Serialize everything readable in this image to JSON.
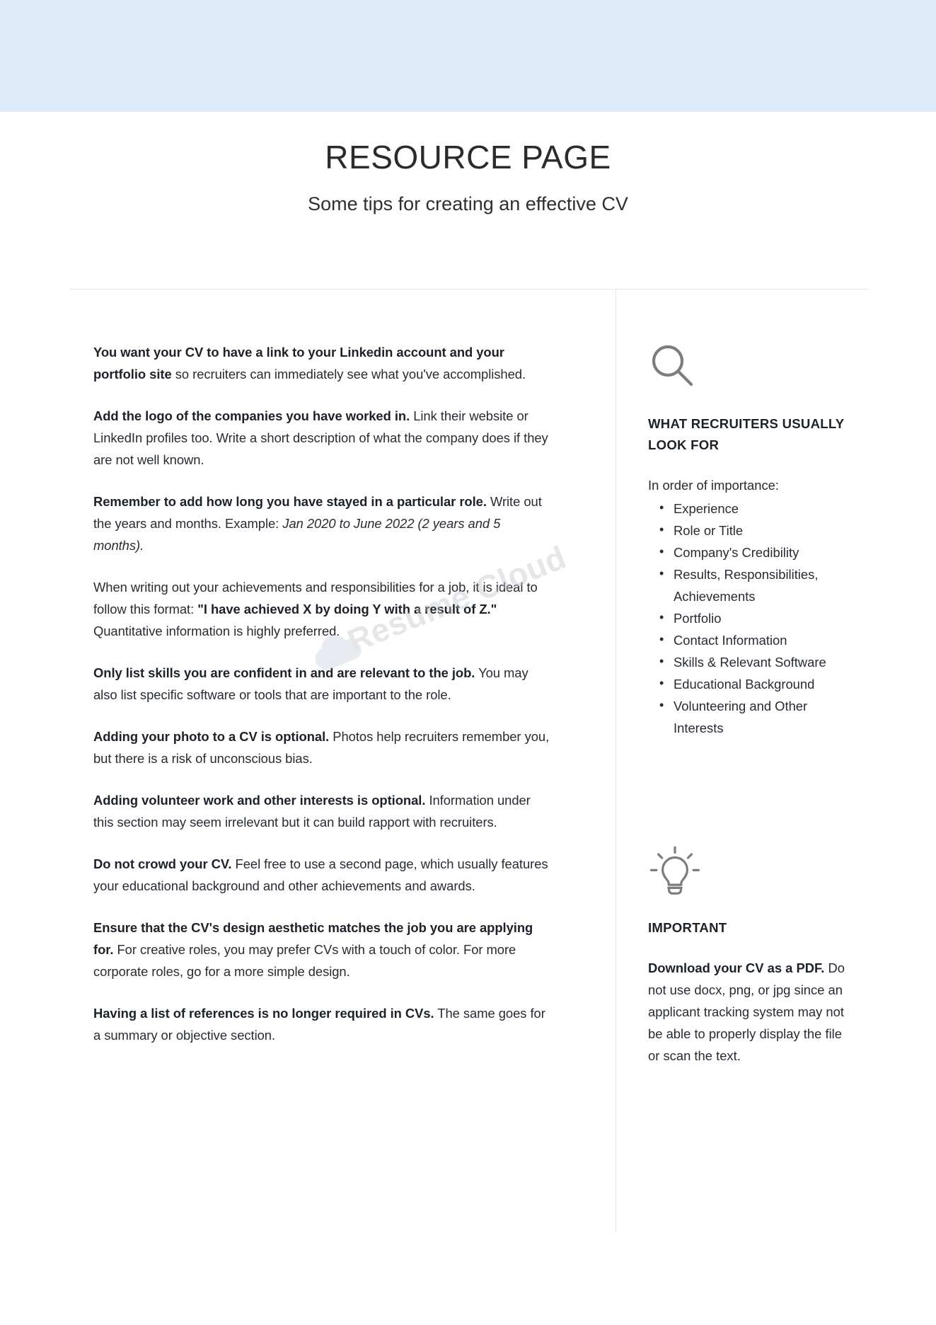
{
  "header": {
    "title": "RESOURCE PAGE",
    "subtitle": "Some tips for creating an effective CV"
  },
  "watermark": {
    "text": "Resume Cloud",
    "cloud_icon": "cloud-icon"
  },
  "tips": [
    {
      "bold": "You want your CV to have a link to your Linkedin account and your portfolio site",
      "rest": " so recruiters can immediately see what you've accomplished."
    },
    {
      "bold": "Add the logo of the companies you have worked in.",
      "rest": " Link their website or LinkedIn profiles too. Write a short description of what the company does if they are not well known."
    },
    {
      "bold": "Remember to add how long you have stayed in a particular role.",
      "rest": " Write out the years and months. Example: ",
      "italic": "Jan 2020 to June 2022 (2 years and 5 months).",
      "tail": ""
    },
    {
      "lead": "When writing out your achievements and responsibilities for a job, it is ideal to follow this format: ",
      "bold": "\"I have achieved X by doing Y with a result of Z.\"",
      "rest": " Quantitative information is highly preferred."
    },
    {
      "bold": "Only list skills you are confident in and are relevant to the job.",
      "rest": " You may also list specific software or tools that are important to the role."
    },
    {
      "bold": "Adding your photo to a CV is optional.",
      "rest": " Photos help recruiters remember you, but there is a risk of unconscious bias."
    },
    {
      "bold": "Adding volunteer work and other interests is optional.",
      "rest": " Information under this section may seem irrelevant but it can build rapport with recruiters."
    },
    {
      "bold": "Do not crowd your CV.",
      "rest": " Feel free to use a second page, which usually features your educational background and other achievements and awards."
    },
    {
      "bold": "Ensure that the CV's design aesthetic matches the job you are applying for.",
      "rest": " For creative roles, you may prefer CVs with a touch of color. For more corporate roles, go for a more simple design."
    },
    {
      "bold": "Having a list of references is no longer required in CVs.",
      "rest": " The same goes for a summary or objective section."
    }
  ],
  "sidebar": {
    "recruiters": {
      "icon": "search-icon",
      "heading": "WHAT RECRUITERS USUALLY LOOK FOR",
      "lead": "In order of importance:",
      "items": [
        "Experience",
        "Role or Title",
        "Company's Credibility",
        "Results, Responsibilities, Achievements",
        "Portfolio",
        "Contact Information",
        "Skills & Relevant Software",
        "Educational Background",
        "Volunteering and Other Interests"
      ]
    },
    "important": {
      "icon": "lightbulb-icon",
      "heading": "IMPORTANT",
      "body_bold": "Download your CV as a PDF.",
      "body_rest": " Do not use docx, png, or jpg since an applicant tracking system may not be able to properly display the file or scan the text."
    }
  },
  "colors": {
    "top_band": "#ddebfb",
    "divider": "#dde7f2",
    "text": "#272c33",
    "icon": "#7d7d7d",
    "watermark": "#c3c6ca"
  }
}
